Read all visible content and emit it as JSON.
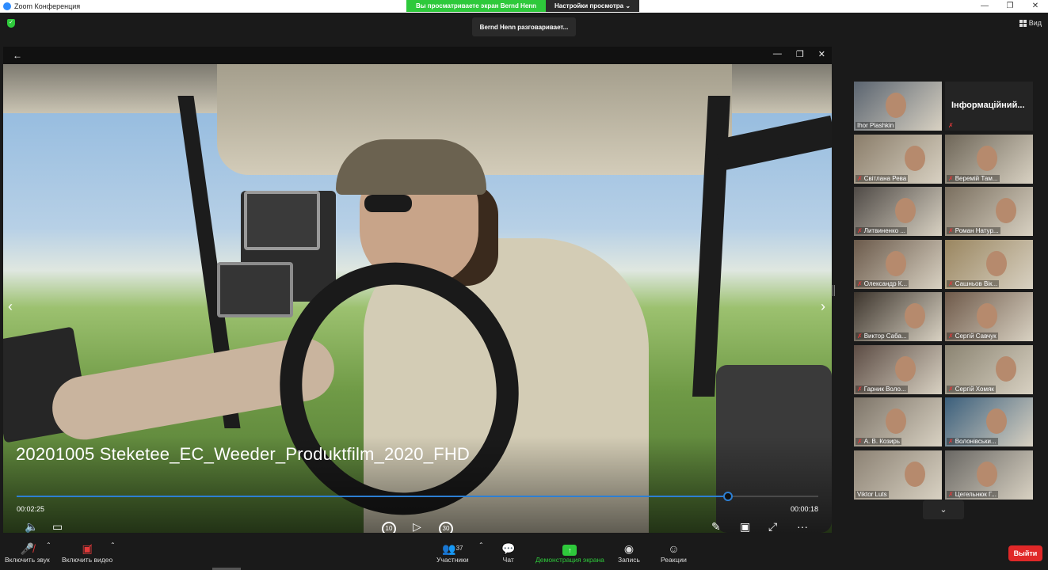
{
  "window": {
    "title": "Zoom Конференция",
    "controls": [
      "—",
      "❐",
      "✕"
    ]
  },
  "share_banner": {
    "viewing_text": "Вы просматриваете экран Bernd Henn",
    "view_settings_label": "Настройки просмотра ⌄"
  },
  "speaker_tooltip": "Bernd Henn разговаривает...",
  "view_button_label": "Вид",
  "shared_screen": {
    "back_glyph": "←",
    "window_controls": [
      "—",
      "❐",
      "✕"
    ],
    "video_title": "20201005 Steketee_EC_Weeder_Produktfilm_2020_FHD",
    "time_current": "00:02:25",
    "time_remaining": "00:00:18",
    "progress_fraction": 0.887,
    "skip_back_label": "10",
    "skip_forward_label": "30"
  },
  "gallery": {
    "tiles": [
      {
        "name": "Ihor Plashkin",
        "muted": false,
        "bg": "#5a6470"
      },
      {
        "name": "Інформаційний...",
        "muted": true,
        "bg": "#242424",
        "name_only": true
      },
      {
        "name": "Світлана Рева",
        "muted": true,
        "bg": "#8a7d6a"
      },
      {
        "name": "Веремій Там...",
        "muted": true,
        "bg": "#6e6658"
      },
      {
        "name": "Литвиненко ...",
        "muted": true,
        "bg": "#4f4a46"
      },
      {
        "name": "Роман Натур...",
        "muted": true,
        "bg": "#7a6f5f"
      },
      {
        "name": "Олександр К...",
        "muted": true,
        "bg": "#6b5a4b"
      },
      {
        "name": "Сашньов Вік...",
        "muted": true,
        "bg": "#9a8660"
      },
      {
        "name": "Виктор Саба...",
        "muted": true,
        "bg": "#3d352d"
      },
      {
        "name": "Сергій Савчук",
        "muted": true,
        "bg": "#6f5a4a"
      },
      {
        "name": "Гарник Воло...",
        "muted": true,
        "bg": "#5c4c44"
      },
      {
        "name": "Сергій Хомяк",
        "muted": true,
        "bg": "#8b8472"
      },
      {
        "name": "А. В. Козирь",
        "muted": true,
        "bg": "#7d7468"
      },
      {
        "name": "Волонівськи...",
        "muted": true,
        "bg": "#3b5f7c"
      },
      {
        "name": "Viktor Luts",
        "muted": false,
        "bg": "#8c8274"
      },
      {
        "name": "Цегельнюк Г...",
        "muted": true,
        "bg": "#6a6864"
      }
    ]
  },
  "toolbar": {
    "audio_label": "Включить звук",
    "video_label": "Включить видео",
    "participants_label": "Участники",
    "participants_count": "37",
    "chat_label": "Чат",
    "share_label": "Демонстрация экрана",
    "record_label": "Запись",
    "reactions_label": "Реакции",
    "leave_label": "Выйти"
  },
  "colors": {
    "share_green": "#2ec93b",
    "progress_blue": "#2d7fd3",
    "leave_red": "#e02828",
    "mute_red": "#e23a3a"
  },
  "icons": {
    "audio": "muted-mic-icon",
    "video": "video-off-icon",
    "participants": "participants-icon",
    "chat": "chat-icon",
    "share": "share-screen-icon",
    "record": "record-icon",
    "reactions": "reactions-icon"
  }
}
